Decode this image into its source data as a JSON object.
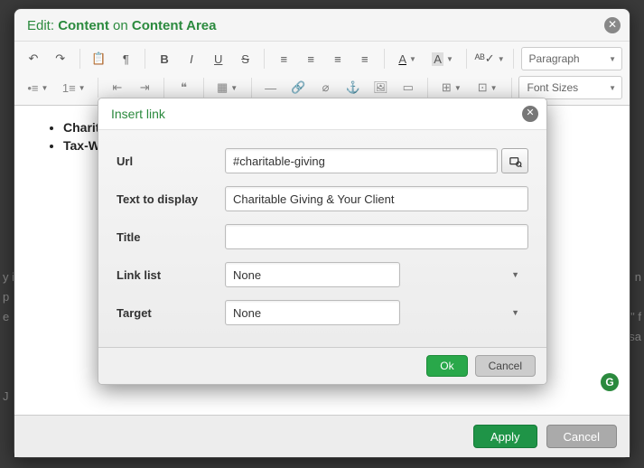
{
  "header": {
    "prefix": "Edit: ",
    "target": "Content",
    "on": " on ",
    "area": "Content Area"
  },
  "toolbar": {
    "paragraph": "Paragraph",
    "font_sizes": "Font Sizes"
  },
  "content": {
    "list": [
      "Charitable",
      "Tax-W"
    ]
  },
  "footer": {
    "apply": "Apply",
    "cancel": "Cancel"
  },
  "insert_link": {
    "title": "Insert link",
    "labels": {
      "url": "Url",
      "text": "Text to display",
      "title": "Title",
      "linklist": "Link list",
      "target": "Target"
    },
    "values": {
      "url": "#charitable-giving",
      "text": "Charitable Giving & Your Client",
      "title": "",
      "linklist": "None",
      "target": "None"
    },
    "buttons": {
      "ok": "Ok",
      "cancel": "Cancel"
    }
  },
  "badge": "G"
}
